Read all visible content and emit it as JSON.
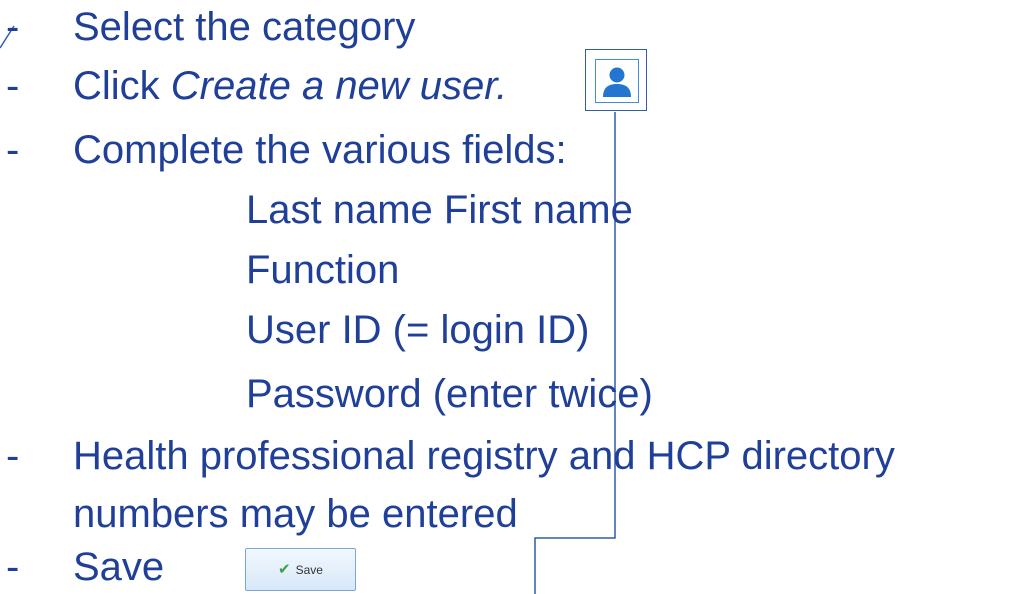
{
  "lines": {
    "select": "Select the category",
    "click_prefix": "Click ",
    "click_italic": "Create a new user.",
    "complete": "Complete the various fields:",
    "field_name": "Last name First name",
    "field_function": "Function",
    "field_user_id": "User ID (= login ID)",
    "field_password": "Password (enter twice)",
    "registry_1": "Health professional registry and HCP directory",
    "registry_2": "numbers may be entered",
    "save": "Save"
  },
  "dash": "-",
  "save_button": {
    "label": "Save",
    "icon": "checkmark-icon"
  },
  "user_icon": "user-icon",
  "colors": {
    "text": "#1f3f99",
    "connector": "#2f5ea5",
    "icon_blue": "#2475cf"
  }
}
